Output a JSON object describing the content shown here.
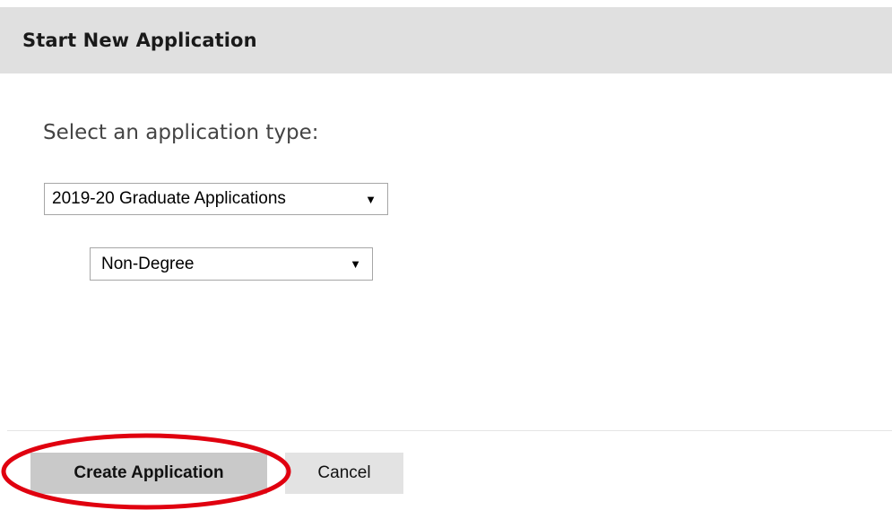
{
  "dialog": {
    "title": "Start New Application"
  },
  "form": {
    "prompt": "Select an application type:",
    "application_type_select": {
      "selected": "2019-20 Graduate Applications"
    },
    "category_select": {
      "selected": "Non-Degree"
    }
  },
  "footer": {
    "create_label": "Create Application",
    "cancel_label": "Cancel"
  },
  "annotation": {
    "highlight_color": "#e0000f"
  },
  "icons": {
    "dropdown": "dropdown-arrow-icon"
  }
}
